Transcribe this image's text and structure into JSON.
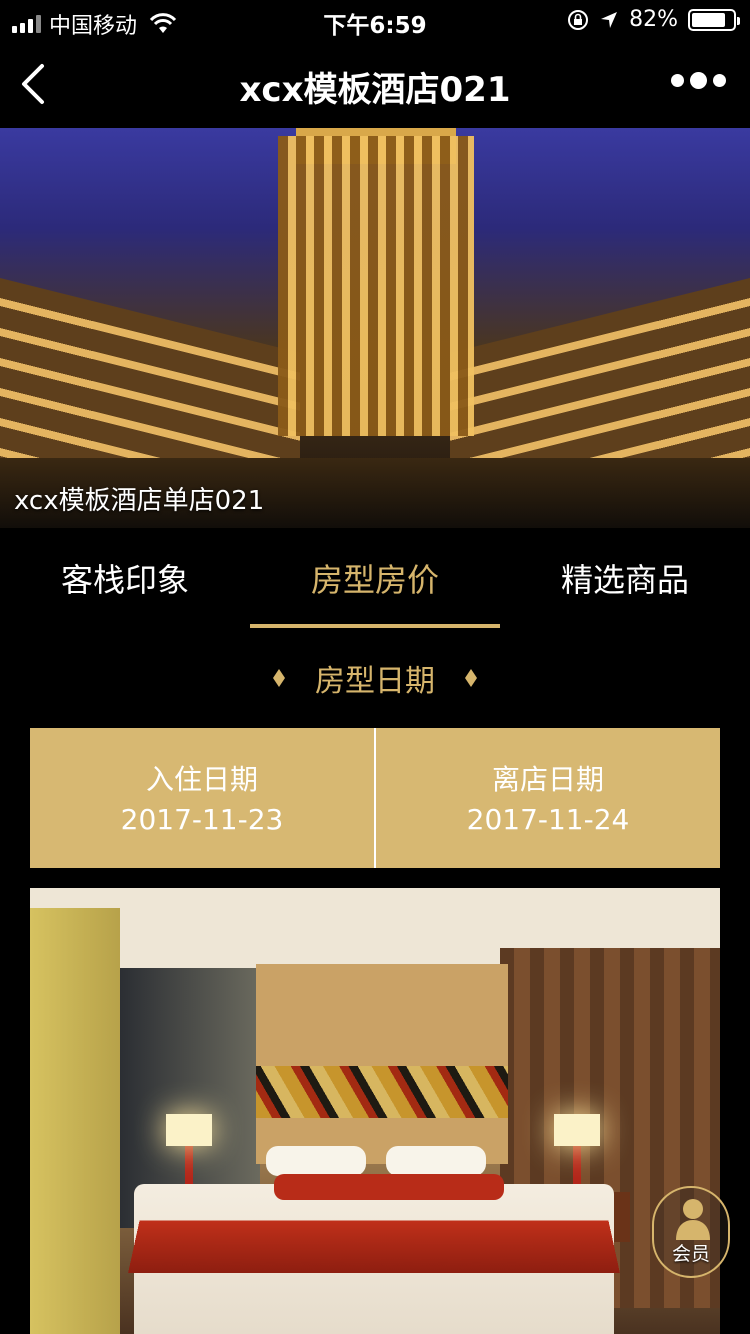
{
  "status_bar": {
    "carrier": "中国移动",
    "time": "下午6:59",
    "battery": "82%",
    "battery_level": 0.82
  },
  "nav": {
    "title": "xcx模板酒店021",
    "back_icon": "chevron-left-icon",
    "more_icon": "more-dots-icon"
  },
  "hero": {
    "caption": "xcx模板酒店单店021"
  },
  "tabs": [
    {
      "label": "客栈印象",
      "active": false
    },
    {
      "label": "房型房价",
      "active": true
    },
    {
      "label": "精选商品",
      "active": false
    }
  ],
  "section": {
    "heading": "房型日期"
  },
  "dates": {
    "checkin_label": "入住日期",
    "checkin_value": "2017-11-23",
    "checkout_label": "离店日期",
    "checkout_value": "2017-11-24"
  },
  "member": {
    "label": "会员",
    "icon": "user-icon"
  },
  "colors": {
    "accent": "#d6b56c",
    "date_box": "#d7b872",
    "background": "#000000"
  }
}
